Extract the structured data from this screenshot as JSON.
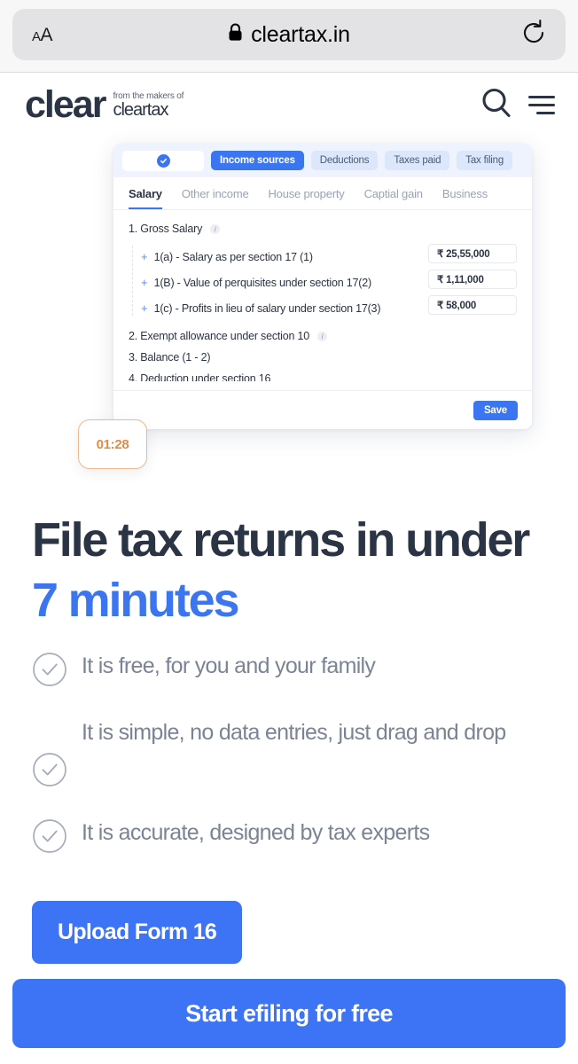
{
  "browser": {
    "text_size_label": "AA",
    "text_size_label_small": "A",
    "lock_icon": "lock-icon",
    "url": "cleartax.in",
    "reload_icon": "reload-icon"
  },
  "header": {
    "logo_main": "clear",
    "logo_sub_line1": "from the makers of",
    "logo_sub_line2": "cleartax",
    "search_icon": "search-icon",
    "menu_icon": "hamburger-menu-icon"
  },
  "product_shot": {
    "step_checkmark_icon": "check-circle-icon",
    "nav_pills": [
      {
        "label": "Income sources",
        "active": true
      },
      {
        "label": "Deductions",
        "active": false
      },
      {
        "label": "Taxes paid",
        "active": false
      },
      {
        "label": "Tax filing",
        "active": false
      }
    ],
    "tabs": [
      {
        "label": "Salary",
        "active": true
      },
      {
        "label": "Other income",
        "active": false
      },
      {
        "label": "House property",
        "active": false
      },
      {
        "label": "Captial gain",
        "active": false
      },
      {
        "label": "Business",
        "active": false
      }
    ],
    "gross_salary_label": "1. Gross Salary",
    "info_icon_glyph": "i",
    "sub_rows": [
      {
        "plus": "+",
        "label": "1(a) - Salary as per section 17 (1)",
        "amount": "₹ 25,55,000"
      },
      {
        "plus": "+",
        "label": "1(B) - Value of perquisites under section 17(2)",
        "amount": "₹ 1,11,000"
      },
      {
        "plus": "+",
        "label": "1(c) - Profits in lieu of salary under section 17(3)",
        "amount": "₹ 58,000"
      }
    ],
    "row_exempt": "2. Exempt allowance under section 10",
    "row_balance": "3. Balance (1 - 2)",
    "row_clipped": "4. Deduction under section 16",
    "save_label": "Save",
    "timer": "01:28"
  },
  "hero": {
    "headline_part1": "File tax returns in under ",
    "headline_accent": "7 minutes",
    "bullets": [
      {
        "icon": "check-circle-icon",
        "text": "It is free, for you and your family"
      },
      {
        "icon": "check-circle-icon",
        "text": "It is simple, no data entries, just drag and drop"
      },
      {
        "icon": "check-circle-icon",
        "text": "It is accurate, designed by tax experts"
      }
    ],
    "upload_label": "Upload Form 16"
  },
  "bottom_cta": {
    "start_label": "Start efiling for free"
  },
  "colors": {
    "accent_blue": "#3d73f5",
    "pill_blue": "#3b76f0",
    "dark_navy": "#2b3445",
    "muted_gray": "#7b8494",
    "timer_orange": "#e08b47"
  }
}
